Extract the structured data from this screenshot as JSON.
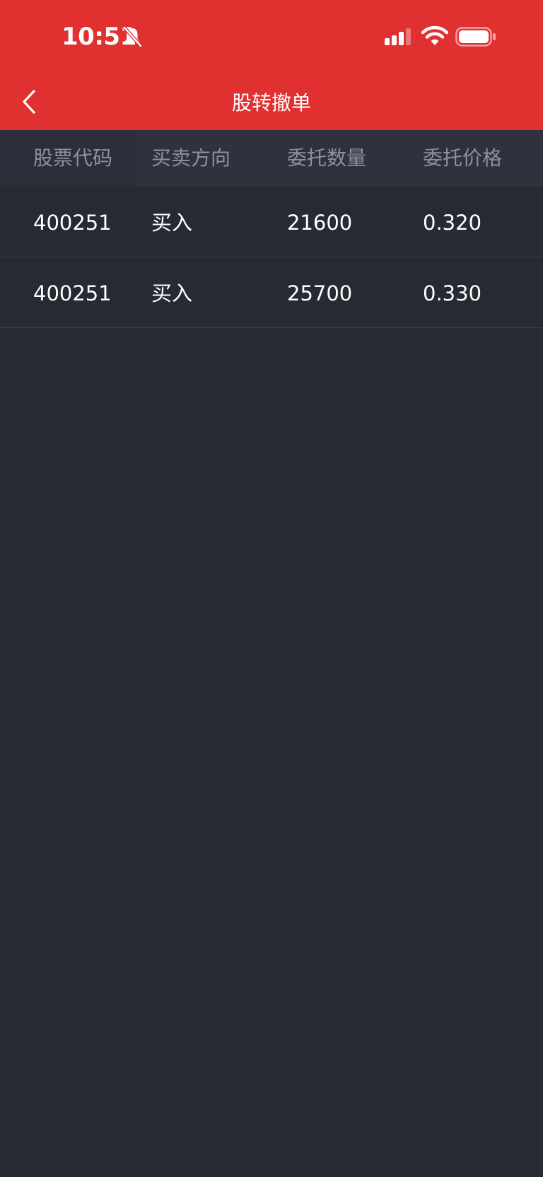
{
  "status_bar": {
    "time": "10:51",
    "icons": [
      "bell-slash-icon",
      "cellular-signal-icon",
      "wifi-icon",
      "battery-icon"
    ]
  },
  "nav": {
    "title": "股转撤单",
    "back_icon": "chevron-left-icon"
  },
  "table": {
    "columns": [
      "股票代码",
      "买卖方向",
      "委托数量",
      "委托价格"
    ],
    "rows": [
      {
        "code": "400251",
        "direction": "买入",
        "quantity": "21600",
        "price": "0.320"
      },
      {
        "code": "400251",
        "direction": "买入",
        "quantity": "25700",
        "price": "0.330"
      }
    ]
  },
  "colors": {
    "header_red": "#e03030",
    "background": "#272a33",
    "table_header_bg": "#2e323d",
    "header_text": "#8c919c",
    "row_text": "#ffffff",
    "divider": "#3a3e4c"
  }
}
